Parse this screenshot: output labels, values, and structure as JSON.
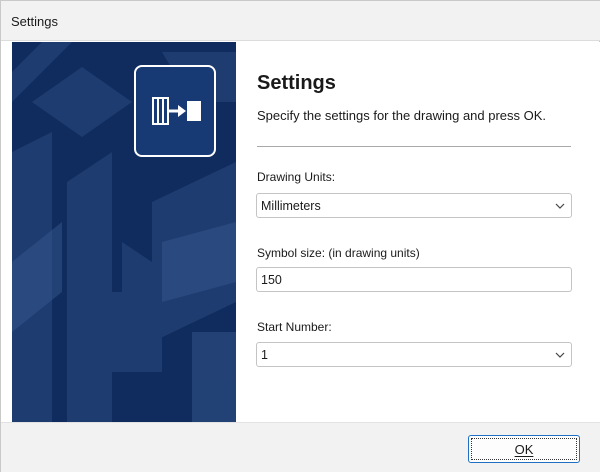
{
  "window": {
    "title": "Settings"
  },
  "header": {
    "title": "Settings",
    "subtitle": "Specify the settings for the drawing and press OK.",
    "icon": "insert-block-icon"
  },
  "form": {
    "drawing_units": {
      "label": "Drawing Units:",
      "value": "Millimeters"
    },
    "symbol_size": {
      "label": "Symbol size: (in drawing units)",
      "value": "150"
    },
    "start_number": {
      "label": "Start Number:",
      "value": "1"
    }
  },
  "footer": {
    "ok_label": "OK"
  },
  "colors": {
    "banner": "#102c5e",
    "accent": "#1f6fc5"
  }
}
